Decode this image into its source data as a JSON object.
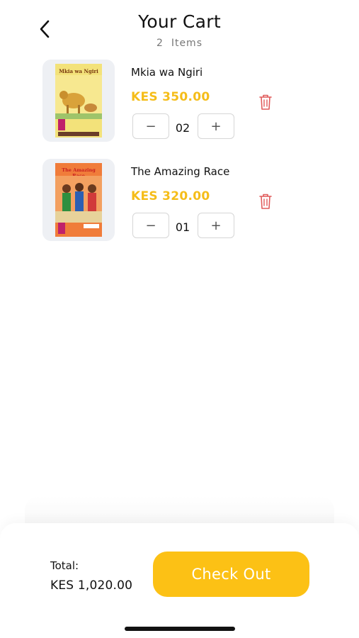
{
  "header": {
    "title": "Your Cart",
    "item_count": "2",
    "item_count_label": "Items"
  },
  "items": [
    {
      "name": "Mkia wa Ngiri",
      "price": "KES 350.00",
      "quantity": "02",
      "cover_title": "Mkia wa Ngiri",
      "cover_color": "#f3e27a"
    },
    {
      "name": "The Amazing Race",
      "price": "KES 320.00",
      "quantity": "01",
      "cover_title": "The Amazing Race",
      "cover_color": "#f07c3a"
    }
  ],
  "qty_controls": {
    "minus": "−",
    "plus": "+"
  },
  "footer": {
    "total_label": "Total:",
    "total_value": "KES 1,020.00",
    "checkout_label": "Check Out"
  },
  "colors": {
    "accent": "#fcc115",
    "price": "#f5bd19",
    "delete": "#e05a5a"
  }
}
